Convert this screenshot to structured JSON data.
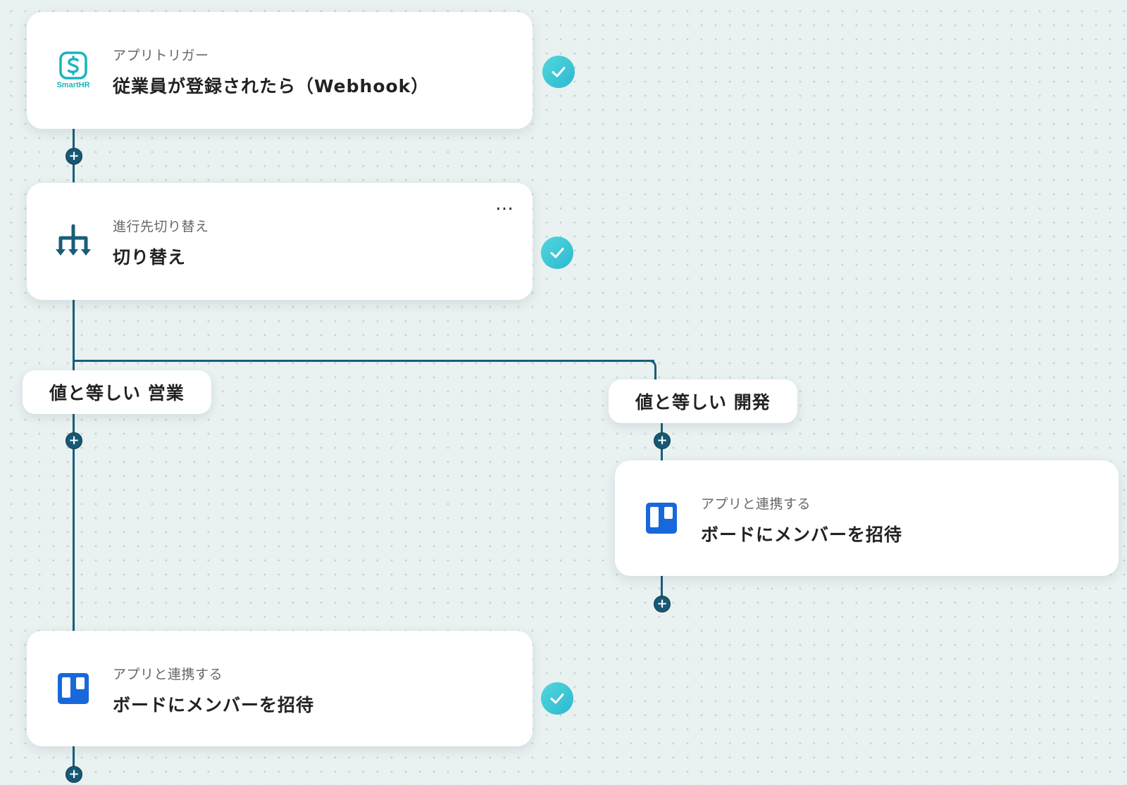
{
  "steps": [
    {
      "id": "trigger",
      "category": "アプリトリガー",
      "title": "従業員が登録されたら（Webhook）",
      "icon": "smarthr-logo-icon",
      "logo_text": "SmartHR",
      "completed": true
    },
    {
      "id": "switch",
      "category": "進行先切り替え",
      "title": "切り替え",
      "icon": "branch-switch-icon",
      "completed": true,
      "menu": "…"
    },
    {
      "id": "trello-left",
      "category": "アプリと連携する",
      "title": "ボードにメンバーを招待",
      "icon": "trello-icon",
      "completed": true
    },
    {
      "id": "trello-right",
      "category": "アプリと連携する",
      "title": "ボードにメンバーを招待",
      "icon": "trello-icon",
      "completed": false
    }
  ],
  "branches": [
    {
      "label": "値と等しい 営業"
    },
    {
      "label": "値と等しい 開発"
    }
  ],
  "add_button_glyph": "+",
  "colors": {
    "connector": "#1a5d7a",
    "check_start": "#52d7dc",
    "check_end": "#2cb8d0",
    "smarthr": "#1ab4bd",
    "trello": "#1868db",
    "switch_icon": "#1a5d7a"
  }
}
